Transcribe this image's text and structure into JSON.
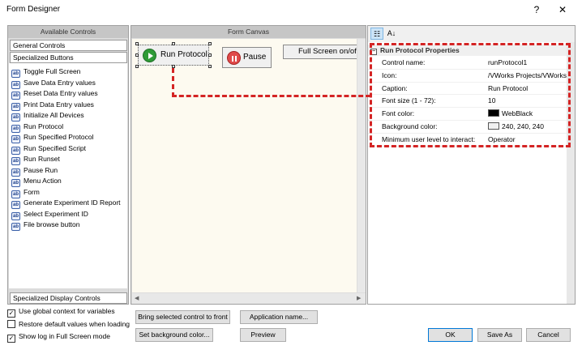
{
  "window": {
    "title": "Form Designer",
    "help": "?",
    "close": "✕"
  },
  "left_panel": {
    "header": "Available Controls",
    "categories": [
      "General Controls",
      "Specialized Buttons"
    ],
    "bottom_category": "Specialized Display Controls",
    "items": [
      "Toggle Full Screen",
      "Save Data Entry values",
      "Reset Data Entry values",
      "Print Data Entry values",
      "Initialize All Devices",
      "Run Protocol",
      "Run Specified Protocol",
      "Run Specified Script",
      "Run Runset",
      "Pause Run",
      "Menu Action",
      "Form",
      "Generate Experiment ID Report",
      "Select Experiment ID",
      "File browse button"
    ],
    "item_icon_text": "ab"
  },
  "canvas": {
    "header": "Form Canvas",
    "buttons": {
      "run_protocol": "Run Protocol",
      "pause": "Pause",
      "full_screen": "Full Screen on/of"
    }
  },
  "properties": {
    "category": "Run Protocol Properties",
    "rows": [
      {
        "name": "Control name:",
        "value": "runProtocol1"
      },
      {
        "name": "Icon:",
        "value": "/VWorks Projects/VWorks"
      },
      {
        "name": "Caption:",
        "value": "Run Protocol"
      },
      {
        "name": "Font size (1 - 72):",
        "value": "10"
      },
      {
        "name": "Font color:",
        "value": "WebBlack",
        "swatch": "#000000"
      },
      {
        "name": "Background color:",
        "value": "240, 240, 240",
        "swatch": "#f0f0f0"
      },
      {
        "name": "Minimum user level to interact:",
        "value": "Operator"
      }
    ]
  },
  "options": {
    "use_global_context": {
      "label": "Use global context for variables",
      "checked": true
    },
    "restore_defaults": {
      "label": "Restore default values when loading",
      "checked": false
    },
    "show_log": {
      "label": "Show log in Full Screen mode",
      "checked": true
    }
  },
  "buttons": {
    "bring_front": "Bring selected control to front",
    "app_name": "Application name...",
    "set_bg": "Set background color...",
    "preview": "Preview",
    "ok": "OK",
    "save_as": "Save As",
    "cancel": "Cancel"
  },
  "colors": {
    "highlight": "#d42424",
    "run_icon": "#2e9b37",
    "pause_icon": "#e04a4a"
  }
}
